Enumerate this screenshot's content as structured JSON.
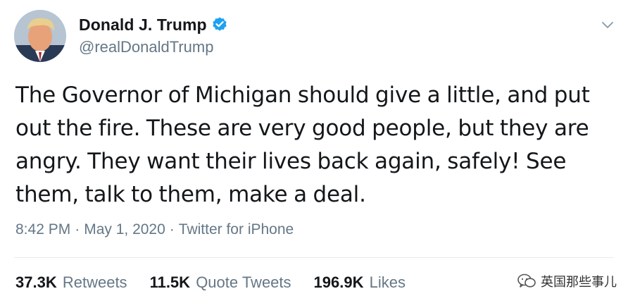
{
  "author": {
    "display_name": "Donald J. Trump",
    "handle": "@realDonaldTrump",
    "verified": true
  },
  "tweet": {
    "text": "The Governor of Michigan should give a little, and put out the fire. These are very good people, but they are angry. They want their lives back again, safely! See them, talk to them, make a deal.",
    "time": "8:42 PM",
    "date": "May 1, 2020",
    "source": "Twitter for iPhone",
    "separator": "·"
  },
  "stats": {
    "retweets_count": "37.3K",
    "retweets_label": "Retweets",
    "quote_count": "11.5K",
    "quote_label": "Quote Tweets",
    "likes_count": "196.9K",
    "likes_label": "Likes"
  },
  "watermark": {
    "text": "英国那些事儿"
  },
  "icons": {
    "verified": "verified-badge-icon",
    "caret": "chevron-down-icon",
    "watermark": "wechat-icon"
  },
  "colors": {
    "text_primary": "#14171a",
    "text_secondary": "#657786",
    "verified_blue": "#1da1f2",
    "divider": "#e6ecf0"
  }
}
